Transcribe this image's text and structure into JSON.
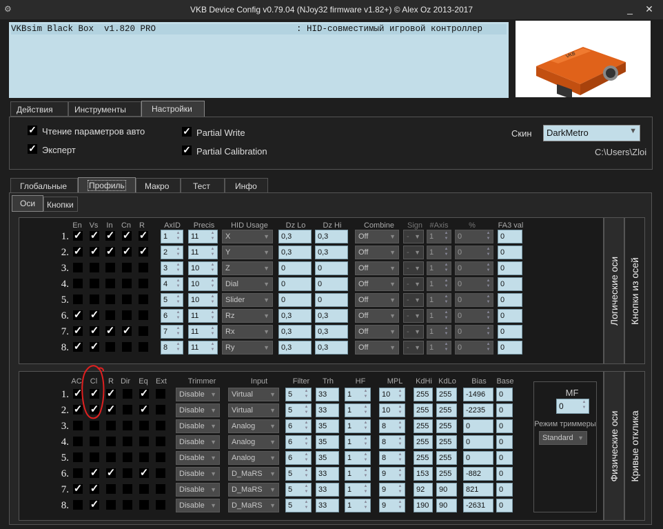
{
  "window": {
    "title": "VKB Device Config v0.79.04 (NJoy32 firmware v1.82+) © Alex Oz 2013-2017",
    "minimize": "_",
    "close": "✕"
  },
  "device": {
    "name": "VKBsim Black Box  v1.820 PRO",
    "desc": ": HID-совместимый игровой контроллер"
  },
  "main_tabs": [
    "Действия",
    "Инструменты",
    "Настройки"
  ],
  "settings": {
    "read_auto": "Чтение параметров авто",
    "expert": "Эксперт",
    "partial_write": "Partial Write",
    "partial_calibration": "Partial Calibration",
    "skin_label": "Скин",
    "skin_value": "DarkMetro",
    "path": "C:\\Users\\Zloi"
  },
  "sub_tabs": [
    "Глобальные",
    "Профиль",
    "Макро",
    "Тест",
    "Инфо"
  ],
  "profile_tabs": [
    "Оси",
    "Кнопки"
  ],
  "side_tabs": {
    "logical": "Логические оси",
    "axis_buttons": "Кнопки из осей",
    "physical": "Физические оси",
    "curves": "Кривые отклика"
  },
  "logical": {
    "headers": {
      "en": "En",
      "vs": "Vs",
      "in": "In",
      "cn": "Cn",
      "r": "R",
      "axid": "AxID",
      "precis": "Precis",
      "hid": "HID Usage",
      "dzlo": "Dz Lo",
      "dzhi": "Dz Hi",
      "combine": "Combine",
      "sign": "Sign",
      "naxis": "#Axis",
      "pct": "%",
      "fa3": "FA3 val"
    },
    "rows": [
      {
        "n": "1.",
        "checks": [
          1,
          1,
          1,
          1,
          1
        ],
        "axid": "1",
        "precis": "11",
        "hid": "X",
        "dzlo": "0,3",
        "dzhi": "0,3",
        "combine": "Off",
        "sign": "-",
        "naxis": "1",
        "pct": "0",
        "fa3": "0"
      },
      {
        "n": "2.",
        "checks": [
          1,
          1,
          1,
          1,
          1
        ],
        "axid": "2",
        "precis": "11",
        "hid": "Y",
        "dzlo": "0,3",
        "dzhi": "0,3",
        "combine": "Off",
        "sign": "-",
        "naxis": "1",
        "pct": "0",
        "fa3": "0"
      },
      {
        "n": "3.",
        "checks": [
          0,
          0,
          0,
          0,
          0
        ],
        "axid": "3",
        "precis": "10",
        "hid": "Z",
        "dzlo": "0",
        "dzhi": "0",
        "combine": "Off",
        "sign": "-",
        "naxis": "1",
        "pct": "0",
        "fa3": "0"
      },
      {
        "n": "4.",
        "checks": [
          0,
          0,
          0,
          0,
          0
        ],
        "axid": "4",
        "precis": "10",
        "hid": "Dial",
        "dzlo": "0",
        "dzhi": "0",
        "combine": "Off",
        "sign": "-",
        "naxis": "1",
        "pct": "0",
        "fa3": "0"
      },
      {
        "n": "5.",
        "checks": [
          0,
          0,
          0,
          0,
          0
        ],
        "axid": "5",
        "precis": "10",
        "hid": "Slider",
        "dzlo": "0",
        "dzhi": "0",
        "combine": "Off",
        "sign": "-",
        "naxis": "1",
        "pct": "0",
        "fa3": "0"
      },
      {
        "n": "6.",
        "checks": [
          1,
          1,
          0,
          0,
          0
        ],
        "axid": "6",
        "precis": "11",
        "hid": "Rz",
        "dzlo": "0,3",
        "dzhi": "0,3",
        "combine": "Off",
        "sign": "-",
        "naxis": "1",
        "pct": "0",
        "fa3": "0"
      },
      {
        "n": "7.",
        "checks": [
          1,
          1,
          1,
          1,
          0
        ],
        "axid": "7",
        "precis": "11",
        "hid": "Rx",
        "dzlo": "0,3",
        "dzhi": "0,3",
        "combine": "Off",
        "sign": "-",
        "naxis": "1",
        "pct": "0",
        "fa3": "0"
      },
      {
        "n": "8.",
        "checks": [
          1,
          1,
          0,
          0,
          0
        ],
        "axid": "8",
        "precis": "11",
        "hid": "Ry",
        "dzlo": "0,3",
        "dzhi": "0,3",
        "combine": "Off",
        "sign": "-",
        "naxis": "1",
        "pct": "0",
        "fa3": "0"
      }
    ]
  },
  "physical": {
    "headers": {
      "ac": "AC",
      "cl": "Cl",
      "r": "R",
      "dir": "Dir",
      "eq": "Eq",
      "ext": "Ext",
      "trimmer": "Trimmer",
      "input": "Input",
      "filter": "Filter",
      "trh": "Trh",
      "hf": "HF",
      "mpl": "MPL",
      "kdhi": "KdHi",
      "kdlo": "KdLo",
      "bias": "Bias",
      "base": "Base"
    },
    "rows": [
      {
        "n": "1.",
        "checks": [
          1,
          1,
          1,
          0,
          1,
          0
        ],
        "trimmer": "Disable",
        "input": "Virtual",
        "filter": "5",
        "trh": "33",
        "hf": "1",
        "mpl": "10",
        "kdhi": "255",
        "kdlo": "255",
        "bias": "-1496",
        "base": "0"
      },
      {
        "n": "2.",
        "checks": [
          1,
          1,
          1,
          0,
          1,
          0
        ],
        "trimmer": "Disable",
        "input": "Virtual",
        "filter": "5",
        "trh": "33",
        "hf": "1",
        "mpl": "10",
        "kdhi": "255",
        "kdlo": "255",
        "bias": "-2235",
        "base": "0"
      },
      {
        "n": "3.",
        "checks": [
          0,
          0,
          0,
          0,
          0,
          0
        ],
        "trimmer": "Disable",
        "input": "Analog",
        "filter": "6",
        "trh": "35",
        "hf": "1",
        "mpl": "8",
        "kdhi": "255",
        "kdlo": "255",
        "bias": "0",
        "base": "0"
      },
      {
        "n": "4.",
        "checks": [
          0,
          0,
          0,
          0,
          0,
          0
        ],
        "trimmer": "Disable",
        "input": "Analog",
        "filter": "6",
        "trh": "35",
        "hf": "1",
        "mpl": "8",
        "kdhi": "255",
        "kdlo": "255",
        "bias": "0",
        "base": "0"
      },
      {
        "n": "5.",
        "checks": [
          0,
          0,
          0,
          0,
          0,
          0
        ],
        "trimmer": "Disable",
        "input": "Analog",
        "filter": "6",
        "trh": "35",
        "hf": "1",
        "mpl": "8",
        "kdhi": "255",
        "kdlo": "255",
        "bias": "0",
        "base": "0"
      },
      {
        "n": "6.",
        "checks": [
          0,
          1,
          1,
          0,
          1,
          0
        ],
        "trimmer": "Disable",
        "input": "D_MaRS",
        "filter": "5",
        "trh": "33",
        "hf": "1",
        "mpl": "9",
        "kdhi": "153",
        "kdlo": "255",
        "bias": "-882",
        "base": "0"
      },
      {
        "n": "7.",
        "checks": [
          1,
          1,
          0,
          0,
          0,
          0
        ],
        "trimmer": "Disable",
        "input": "D_MaRS",
        "filter": "5",
        "trh": "33",
        "hf": "1",
        "mpl": "9",
        "kdhi": "92",
        "kdlo": "90",
        "bias": "821",
        "base": "0"
      },
      {
        "n": "8.",
        "checks": [
          0,
          1,
          0,
          0,
          0,
          0
        ],
        "trimmer": "Disable",
        "input": "D_MaRS",
        "filter": "5",
        "trh": "33",
        "hf": "1",
        "mpl": "9",
        "kdhi": "190",
        "kdlo": "90",
        "bias": "-2631",
        "base": "0"
      }
    ]
  },
  "mf": {
    "label": "MF",
    "value": "0",
    "trim_label": "Режим триммеры",
    "trim_value": "Standard"
  },
  "check_glyph": "✓",
  "colors": {
    "field_bg": "#c2dde8",
    "annotation": "#e02020"
  }
}
